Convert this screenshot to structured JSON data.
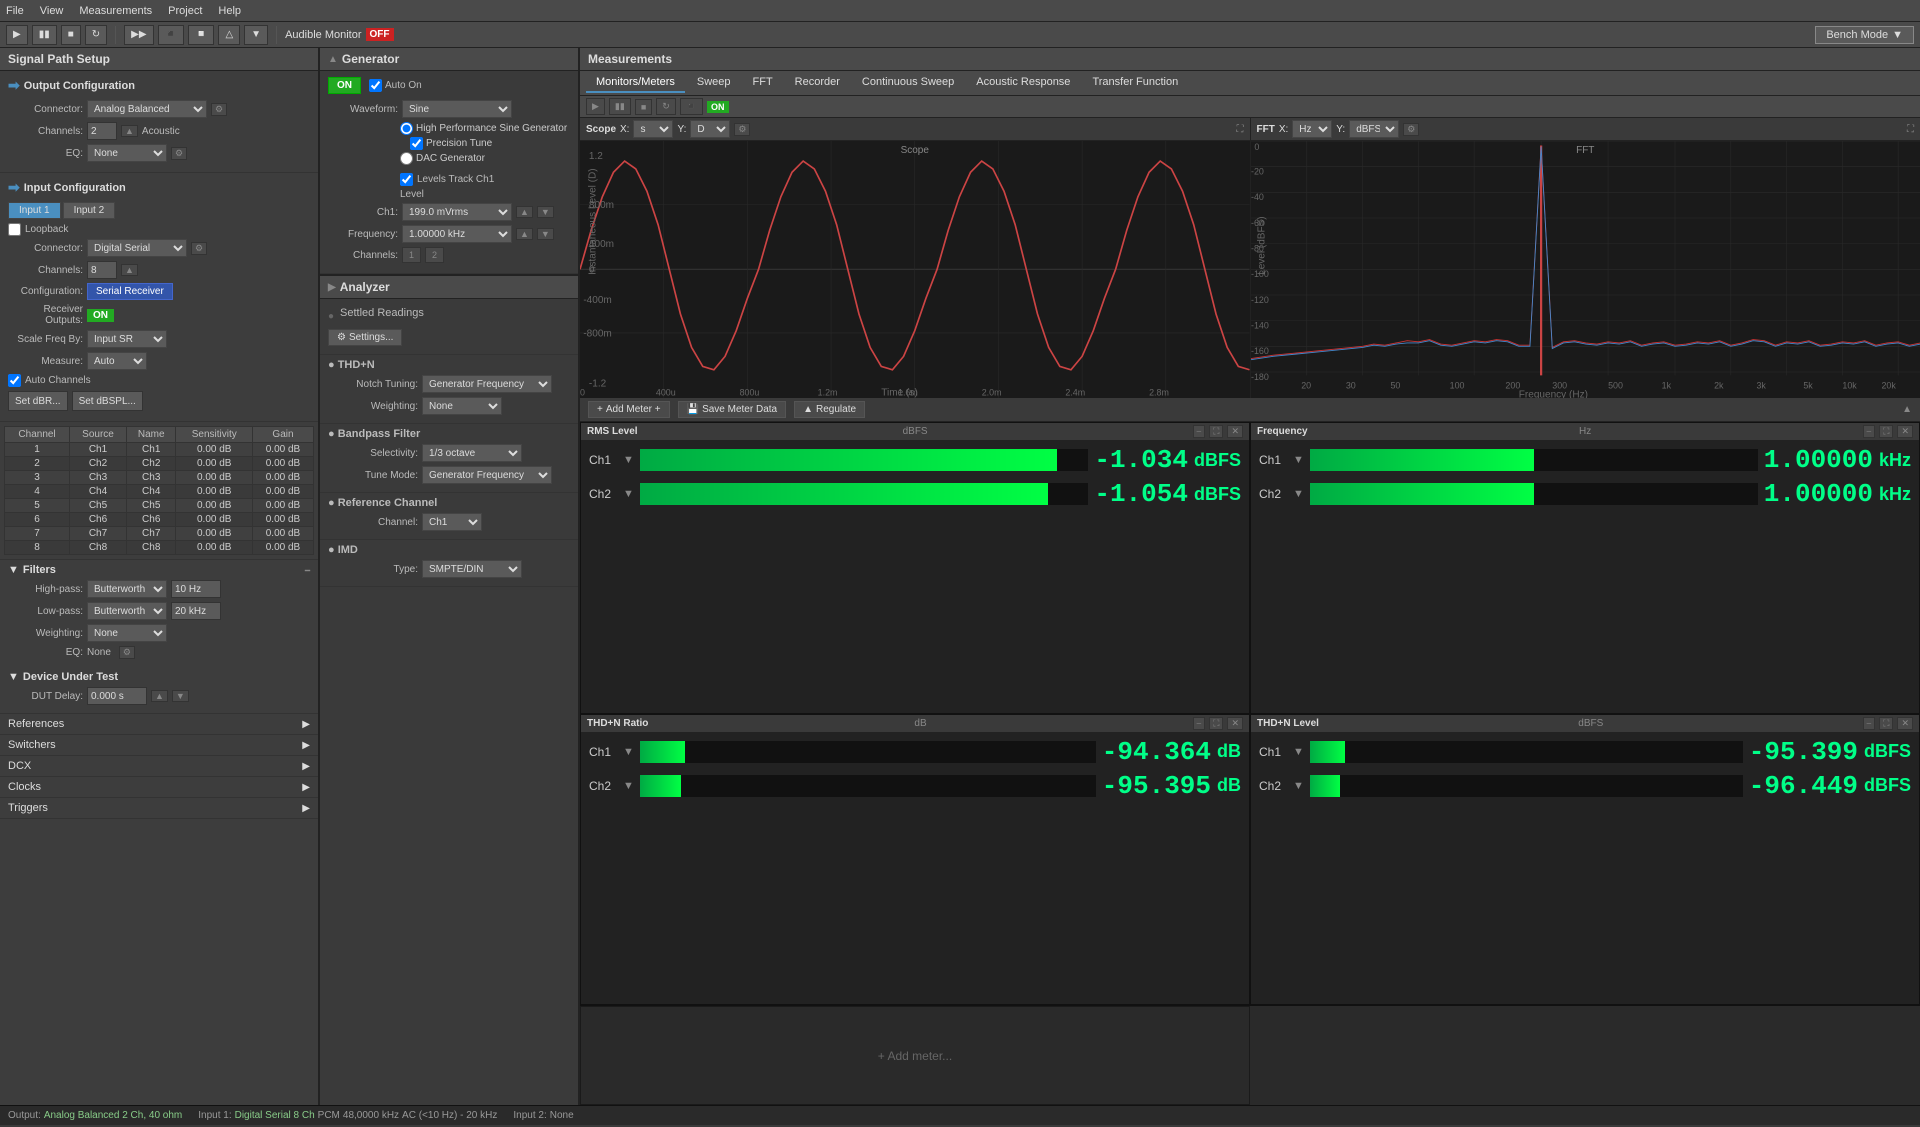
{
  "menubar": {
    "items": [
      "File",
      "View",
      "Measurements",
      "Project",
      "Help"
    ]
  },
  "toolbar": {
    "audible_monitor": "Audible Monitor",
    "off_label": "OFF",
    "bench_mode": "Bench Mode"
  },
  "left_panel": {
    "title": "Signal Path Setup",
    "output_config": {
      "label": "Output Configuration",
      "connector_label": "Connector:",
      "connector_value": "Analog Balanced",
      "channels_label": "Channels:",
      "channels_value": "2",
      "acoustic_label": "Acoustic",
      "eq_label": "EQ:",
      "eq_value": "None"
    },
    "input_config": {
      "label": "Input Configuration",
      "tabs": [
        "Input 1",
        "Input 2"
      ],
      "loopback_label": "Loopback",
      "connector_label": "Connector:",
      "connector_value": "Digital Serial",
      "channels_label": "Channels:",
      "channels_value": "8",
      "configuration_label": "Configuration:",
      "configuration_value": "Serial Receiver",
      "receiver_outputs_label": "Receiver Outputs:",
      "receiver_outputs_value": "ON",
      "scale_freq_label": "Scale Freq By:",
      "scale_freq_value": "Input SR",
      "measure_label": "Measure:",
      "measure_value": "Auto",
      "auto_channels_label": "Auto Channels",
      "set_dbr_btn": "Set dBR...",
      "set_dbspl_btn": "Set dBSPL..."
    },
    "channel_table": {
      "headers": [
        "Channel",
        "Source",
        "Name",
        "Sensitivity",
        "Gain"
      ],
      "rows": [
        {
          "ch": "1",
          "src": "Ch1",
          "name": "Ch1",
          "sens": "0.00 dB",
          "gain": "0.00 dB"
        },
        {
          "ch": "2",
          "src": "Ch2",
          "name": "Ch2",
          "sens": "0.00 dB",
          "gain": "0.00 dB"
        },
        {
          "ch": "3",
          "src": "Ch3",
          "name": "Ch3",
          "sens": "0.00 dB",
          "gain": "0.00 dB"
        },
        {
          "ch": "4",
          "src": "Ch4",
          "name": "Ch4",
          "sens": "0.00 dB",
          "gain": "0.00 dB"
        },
        {
          "ch": "5",
          "src": "Ch5",
          "name": "Ch5",
          "sens": "0.00 dB",
          "gain": "0.00 dB"
        },
        {
          "ch": "6",
          "src": "Ch6",
          "name": "Ch6",
          "sens": "0.00 dB",
          "gain": "0.00 dB"
        },
        {
          "ch": "7",
          "src": "Ch7",
          "name": "Ch7",
          "sens": "0.00 dB",
          "gain": "0.00 dB"
        },
        {
          "ch": "8",
          "src": "Ch8",
          "name": "Ch8",
          "sens": "0.00 dB",
          "gain": "0.00 dB"
        }
      ]
    },
    "filters": {
      "label": "Filters",
      "highpass_label": "High-pass:",
      "highpass_type": "Butterworth",
      "highpass_freq": "10 Hz",
      "lowpass_label": "Low-pass:",
      "lowpass_type": "Butterworth",
      "lowpass_freq": "20 kHz",
      "weighting_label": "Weighting:",
      "weighting_value": "None",
      "eq_label": "EQ:",
      "eq_value": "None"
    },
    "dut": {
      "label": "Device Under Test",
      "delay_label": "DUT Delay:",
      "delay_value": "0.000 s"
    },
    "nav_items": [
      "References",
      "Switchers",
      "DCX",
      "Clocks",
      "Triggers"
    ]
  },
  "generator": {
    "title": "Generator",
    "on_label": "ON",
    "auto_on_label": "Auto On",
    "waveform_label": "Waveform:",
    "waveform_value": "Sine",
    "hp_sine_label": "High Performance Sine Generator",
    "precision_tune_label": "Precision Tune",
    "dac_generator_label": "DAC Generator",
    "levels_track_label": "Levels Track Ch1",
    "level_label": "Level",
    "ch1_label": "Ch1:",
    "ch1_value": "199.0 mVrms",
    "frequency_label": "Frequency:",
    "frequency_value": "1.00000 kHz",
    "channels_label": "Channels:"
  },
  "analyzer": {
    "title": "Analyzer",
    "settled_readings": "Settled Readings",
    "settings_btn": "Settings...",
    "thdn": {
      "label": "THD+N",
      "notch_tuning_label": "Notch Tuning:",
      "notch_tuning_value": "Generator Frequency",
      "weighting_label": "Weighting:",
      "weighting_value": "None"
    },
    "bandpass": {
      "label": "Bandpass Filter",
      "selectivity_label": "Selectivity:",
      "selectivity_value": "1/3 octave",
      "tune_mode_label": "Tune Mode:",
      "tune_mode_value": "Generator Frequency"
    },
    "reference_channel": {
      "label": "Reference Channel",
      "channel_label": "Channel:",
      "channel_value": "Ch1"
    },
    "imd": {
      "label": "IMD",
      "type_label": "Type:",
      "type_value": "SMPTE/DIN"
    }
  },
  "measurements": {
    "title": "Measurements",
    "tabs": [
      "Monitors/Meters",
      "Sweep",
      "FFT",
      "Recorder",
      "Continuous Sweep",
      "Acoustic Response",
      "Transfer Function"
    ],
    "active_tab": "Monitors/Meters",
    "add_meter_btn": "Add Meter +",
    "save_meter_data_btn": "Save Meter Data",
    "regulate_btn": "Regulate",
    "scope": {
      "title": "Scope",
      "x_label": "X:",
      "x_unit": "s",
      "y_label": "Y:",
      "y_unit": "D",
      "chart_title": "Scope",
      "y_values": [
        "1.2",
        "800m",
        "400m",
        "0",
        "-400m",
        "-800m",
        "-1.2"
      ],
      "x_values": [
        "0",
        "400u",
        "800u",
        "1.2m",
        "1.6m",
        "2.0m",
        "2.4m",
        "2.8m"
      ]
    },
    "fft": {
      "title": "FFT",
      "x_label": "X:",
      "x_unit": "Hz",
      "y_label": "Y:",
      "y_unit": "dBFS",
      "chart_title": "FFT",
      "y_values": [
        "0",
        "-20",
        "-40",
        "-60",
        "-80",
        "-100",
        "-120",
        "-140",
        "-160",
        "-180"
      ],
      "x_values": [
        "20",
        "30",
        "50",
        "100",
        "200",
        "300",
        "500",
        "1k",
        "2k",
        "3k",
        "5k",
        "10k",
        "20k"
      ]
    },
    "rms_meter": {
      "title": "RMS Level",
      "unit": "dBFS",
      "ch1_value": "-1.034",
      "ch1_unit": "dBFS",
      "ch1_bar_pct": 92,
      "ch2_value": "-1.054",
      "ch2_unit": "dBFS",
      "ch2_bar_pct": 91
    },
    "frequency_meter": {
      "title": "Frequency",
      "unit": "Hz",
      "ch1_value": "1.00000",
      "ch1_unit": "kHz",
      "ch1_bar_pct": 50,
      "ch2_value": "1.00000",
      "ch2_unit": "kHz",
      "ch2_bar_pct": 50
    },
    "thdn_ratio_meter": {
      "title": "THD+N Ratio",
      "unit": "dB",
      "ch1_value": "-94.364",
      "ch1_unit": "dB",
      "ch1_bar_pct": 10,
      "ch2_value": "-95.395",
      "ch2_unit": "dB",
      "ch2_bar_pct": 10
    },
    "thdn_level_meter": {
      "title": "THD+N Level",
      "unit": "dBFS",
      "ch1_value": "-95.399",
      "ch1_unit": "dBFS",
      "ch1_bar_pct": 8,
      "ch2_value": "-96.449",
      "ch2_unit": "dBFS",
      "ch2_bar_pct": 7
    },
    "add_meter_label": "+ Add meter..."
  },
  "status_bar": {
    "output_label": "Output:",
    "output_value": "Analog Balanced 2 Ch, 40 ohm",
    "input1_label": "Input 1:",
    "input1_value": "Digital Serial 8 Ch",
    "pcm_label": "PCM",
    "freq_value": "48,0000 kHz",
    "ac_value": "AC (<10 Hz) - 20 kHz",
    "input2_label": "Input 2:",
    "input2_value": "None"
  }
}
